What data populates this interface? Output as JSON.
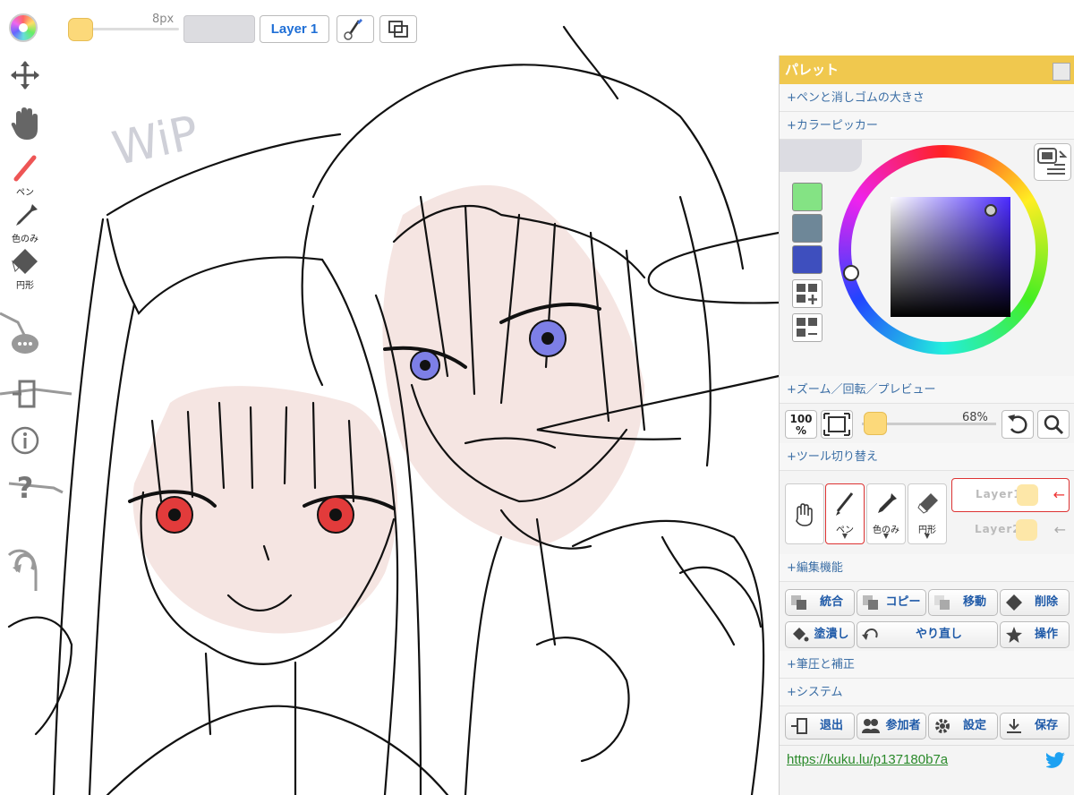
{
  "toolbar": {
    "size_label": "8px",
    "layer_button_label": "Layer 1"
  },
  "left_tools": {
    "pen_label": "ペン",
    "eyedropper_label": "色のみ",
    "shape_label": "円形"
  },
  "canvas": {
    "wip_text": "WiP"
  },
  "palette": {
    "title": "パレット",
    "sections": {
      "pen_eraser_size": "+ペンと消しゴムの大きさ",
      "color_picker": "+カラーピッカー",
      "zoom": "+ズーム／回転／プレビュー",
      "tool_switch": "+ツール切り替え",
      "edit": "+編集機能",
      "pressure": "+筆圧と補正",
      "system": "+システム"
    },
    "color_swatches": [
      "#84e384",
      "#6e8798",
      "#3e4fbe"
    ],
    "zoom": {
      "percent_label": "100\n%",
      "zoom_value": "68%"
    },
    "tools": {
      "pen": "ペン",
      "eyedropper": "色のみ",
      "shape": "円形",
      "arrow": "▼"
    },
    "layers": [
      {
        "name": "Layer1",
        "active": true
      },
      {
        "name": "Layer2",
        "active": false
      }
    ],
    "edit_buttons": {
      "merge": "統合",
      "copy": "コピー",
      "move": "移動",
      "delete": "削除",
      "fill": "塗潰し",
      "redo": "やり直し",
      "operation": "操作"
    },
    "system_buttons": {
      "exit": "退出",
      "participants": "参加者",
      "settings": "設定",
      "save": "保存"
    },
    "link": "https://kuku.lu/p137180b7a"
  },
  "colors": {
    "accent": "#f0c84e",
    "link_blue": "#1f6fd6",
    "layer_active_border": "#d33333"
  }
}
